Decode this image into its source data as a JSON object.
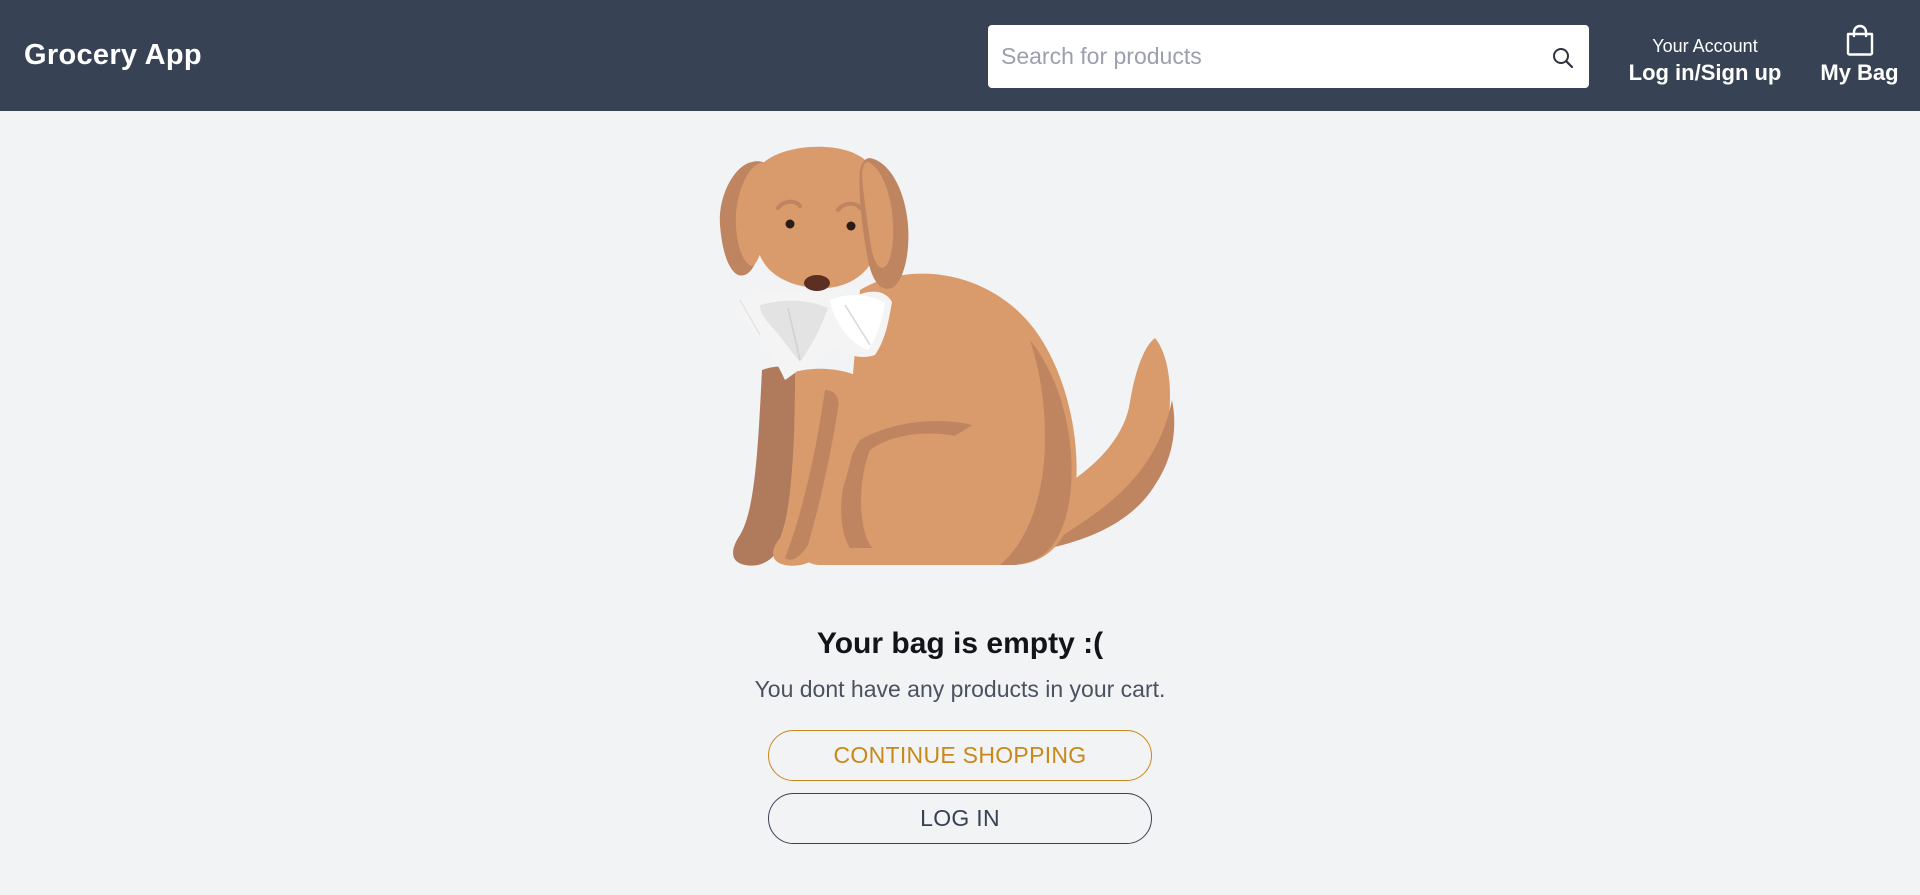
{
  "header": {
    "brand": "Grocery App",
    "search": {
      "placeholder": "Search for products",
      "value": "",
      "icon": "search-icon"
    },
    "account": {
      "small_label": "Your Account",
      "action_label": "Log in/Sign up"
    },
    "bag": {
      "icon": "shopping-bag-icon",
      "label": "My Bag"
    }
  },
  "main": {
    "illustration": "dog-holding-paper-illustration",
    "title": "Your bag is empty :(",
    "subtitle": "You dont have any products in your cart.",
    "continue_button": "CONTINUE SHOPPING",
    "login_button": "LOG IN"
  },
  "colors": {
    "header_bg": "#374254",
    "page_bg": "#f2f3f5",
    "accent": "#c8881a",
    "dog_fur": "#d99a6c"
  }
}
